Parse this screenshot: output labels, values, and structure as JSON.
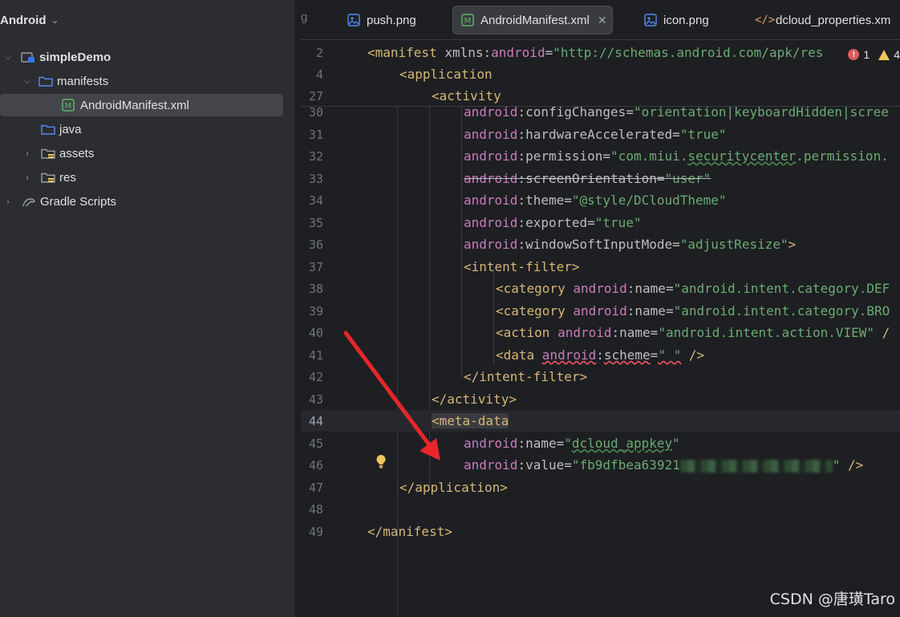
{
  "project": {
    "view_mode": "Android",
    "tree": [
      {
        "label": "simpleDemo",
        "expanded": true,
        "icon": "module-icon"
      },
      {
        "label": "manifests",
        "expanded": true,
        "icon": "folder-icon"
      },
      {
        "label": "AndroidManifest.xml",
        "icon": "manifest-file-icon",
        "selected": true
      },
      {
        "label": "java",
        "icon": "folder-icon"
      },
      {
        "label": "assets",
        "expanded": false,
        "icon": "resource-folder-icon"
      },
      {
        "label": "res",
        "expanded": false,
        "icon": "resource-folder-icon"
      },
      {
        "label": "Gradle Scripts",
        "expanded": false,
        "icon": "gradle-icon"
      }
    ]
  },
  "tabs": [
    {
      "label": "g",
      "partial": true
    },
    {
      "label": "push.png",
      "icon": "image-icon"
    },
    {
      "label": "AndroidManifest.xml",
      "icon": "manifest-file-icon",
      "active": true
    },
    {
      "label": "icon.png",
      "icon": "image-icon"
    },
    {
      "label": "dcloud_properties.xm",
      "icon": "xml-icon",
      "partial": true
    }
  ],
  "inspection": {
    "errors": "1",
    "warnings": "4"
  },
  "code": {
    "sticky": [
      {
        "num": "2",
        "text": "<manifest xmlns:android=\"http://schemas.android.com/apk/res"
      },
      {
        "num": "4",
        "text": "<application"
      },
      {
        "num": "27",
        "text": "<activity"
      }
    ],
    "lines": [
      {
        "num": "30",
        "text": "android:configChanges=\"orientation|keyboardHidden|scree"
      },
      {
        "num": "31",
        "text": "android:hardwareAccelerated=\"true\""
      },
      {
        "num": "32",
        "text": "android:permission=\"com.miui.securitycenter.permission."
      },
      {
        "num": "33",
        "text": "android:screenOrientation=\"user\""
      },
      {
        "num": "34",
        "text": "android:theme=\"@style/DCloudTheme\""
      },
      {
        "num": "35",
        "text": "android:exported=\"true\""
      },
      {
        "num": "36",
        "text": "android:windowSoftInputMode=\"adjustResize\">"
      },
      {
        "num": "37",
        "text": "<intent-filter>"
      },
      {
        "num": "38",
        "text": "<category android:name=\"android.intent.category.DEF"
      },
      {
        "num": "39",
        "text": "<category android:name=\"android.intent.category.BRO"
      },
      {
        "num": "40",
        "text": "<action android:name=\"android.intent.action.VIEW\" /"
      },
      {
        "num": "41",
        "text": "<data android:scheme=\" \" />"
      },
      {
        "num": "42",
        "text": "</intent-filter>"
      },
      {
        "num": "43",
        "text": "</activity>"
      },
      {
        "num": "44",
        "text": "<meta-data"
      },
      {
        "num": "45",
        "text": "android:name=\"dcloud_appkey\""
      },
      {
        "num": "46",
        "text": "android:value=\"fb9dfbea63921[redacted]\" />"
      },
      {
        "num": "47",
        "text": "</application>"
      },
      {
        "num": "48",
        "text": ""
      },
      {
        "num": "49",
        "text": "</manifest>"
      }
    ],
    "current_line": "44"
  },
  "watermark": "CSDN @唐璜Taro",
  "colors": {
    "arrow": "#e8262b",
    "tag": "#d5b778",
    "namespace": "#c77dbb",
    "string": "#6aab73"
  }
}
